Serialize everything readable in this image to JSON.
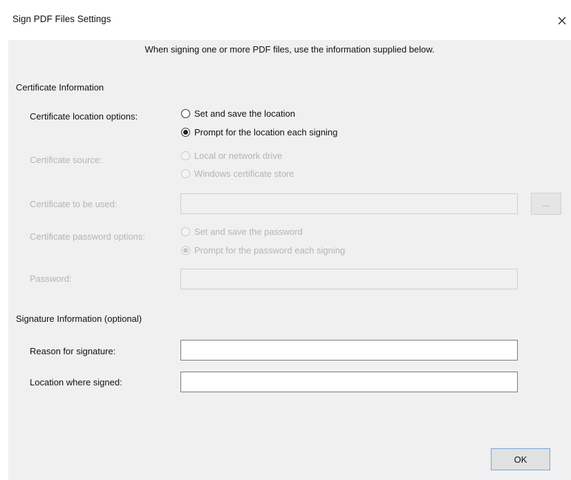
{
  "window": {
    "title": "Sign PDF Files Settings",
    "close_glyph": "✕"
  },
  "intro": "When signing one or more PDF files, use the information supplied below.",
  "certificate": {
    "section_title": "Certificate Information",
    "location": {
      "label": "Certificate location options:",
      "options": [
        "Set and save the location",
        "Prompt for the location each signing"
      ],
      "selected": 1
    },
    "source": {
      "label": "Certificate source:",
      "options": [
        "Local or network drive",
        "Windows certificate store"
      ],
      "enabled": false
    },
    "to_be_used": {
      "label": "Certificate to be used:",
      "value": "",
      "browse_label": "...",
      "enabled": false
    },
    "password_options": {
      "label": "Certificate password options:",
      "options": [
        "Set and save the password",
        "Prompt for the password each signing"
      ],
      "selected": 1,
      "enabled": false
    },
    "password": {
      "label": "Password:",
      "value": "",
      "enabled": false
    }
  },
  "signature": {
    "section_title": "Signature Information (optional)",
    "reason": {
      "label": "Reason for signature:",
      "value": ""
    },
    "location": {
      "label": "Location where signed:",
      "value": ""
    }
  },
  "footer": {
    "ok_label": "OK"
  }
}
